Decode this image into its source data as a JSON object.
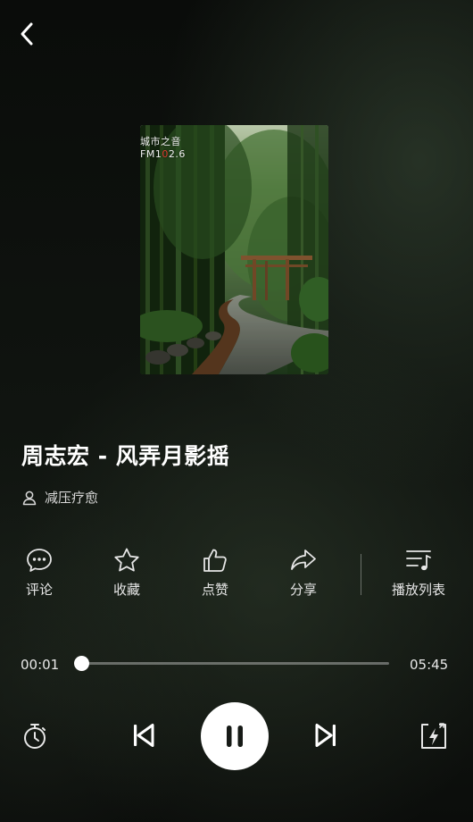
{
  "cover": {
    "station_name": "城市之音",
    "station_freq_pre": "FM1",
    "station_freq_mid": "0",
    "station_freq_post": "2.6"
  },
  "song": {
    "title": "周志宏 - 风弄月影摇",
    "artist": "减压疗愈"
  },
  "actions": [
    {
      "label": "评论",
      "icon": "comment-icon"
    },
    {
      "label": "收藏",
      "icon": "star-icon"
    },
    {
      "label": "点赞",
      "icon": "thumbs-up-icon"
    },
    {
      "label": "分享",
      "icon": "share-icon"
    },
    {
      "label": "播放列表",
      "icon": "playlist-icon"
    }
  ],
  "progress": {
    "current": "00:01",
    "total": "05:45",
    "fraction": 0.003
  },
  "controls": {
    "timer": "timer-icon",
    "previous": "skip-previous-icon",
    "play_state": "pause-icon",
    "next": "skip-next-icon",
    "mode": "fast-mode-icon"
  },
  "colors": {
    "accent": "#ffffff",
    "station_red": "#e03a2f"
  }
}
